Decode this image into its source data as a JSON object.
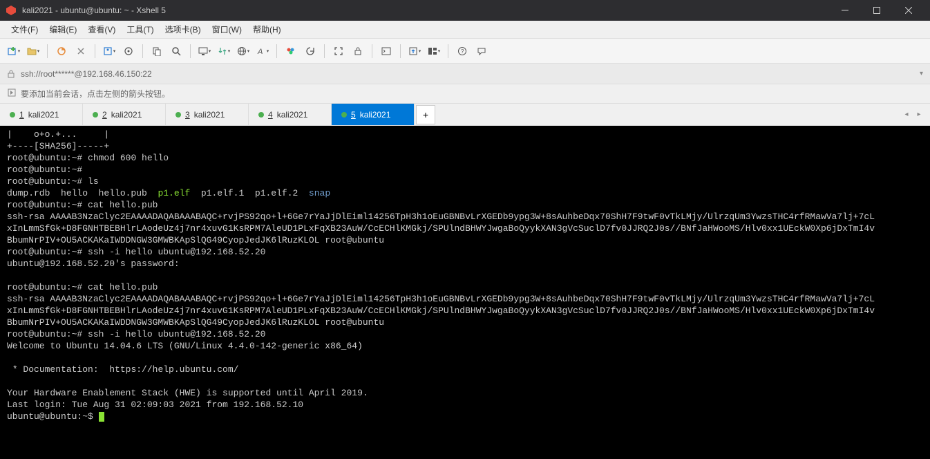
{
  "window": {
    "title": "kali2021 - ubuntu@ubuntu: ~ - Xshell 5"
  },
  "menubar": [
    "文件(F)",
    "编辑(E)",
    "查看(V)",
    "工具(T)",
    "选项卡(B)",
    "窗口(W)",
    "帮助(H)"
  ],
  "address": "ssh://root******@192.168.46.150:22",
  "tip": "要添加当前会话，点击左侧的箭头按钮。",
  "tabs": [
    {
      "num": "1",
      "label": "kali2021",
      "active": false
    },
    {
      "num": "2",
      "label": "kali2021",
      "active": false
    },
    {
      "num": "3",
      "label": "kali2021",
      "active": false
    },
    {
      "num": "4",
      "label": "kali2021",
      "active": false
    },
    {
      "num": "5",
      "label": "kali2021",
      "active": true
    }
  ],
  "terminal": {
    "randart": "|    o+o.+...     |",
    "sha_line": "+----[SHA256]-----+",
    "rootprompt": "root@ubuntu:~#",
    "ubuntuprompt": "ubuntu@ubuntu:~$",
    "cmd_chmod": "chmod 600 hello",
    "cmd_ls": "ls",
    "ls_out": {
      "p1": "dump.rdb  hello  hello.pub",
      "p2": "p1.elf",
      "p3": "p1.elf.1  p1.elf.2",
      "p4": "snap"
    },
    "cmd_cat": "cat hello.pub",
    "pub_l1": "ssh-rsa AAAAB3NzaClyc2EAAAADAQABAAABAQC+rvjPS92qo+l+6Ge7rYaJjDlEiml14256TpH3h1oEuGBNBvLrXGEDb9ypg3W+8sAuhbeDqx70ShH7F9twF0vTkLMjy/UlrzqUm3YwzsTHC4rfRMawVa7lj+7cL",
    "pub_l2": "xInLmmSfGk+D8FGNHTBEBHlrLAodeUz4j7nr4xuvG1KsRPM7AleUD1PLxFqXB23AuW/CcECHlKMGkj/SPUlndBHWYJwgaBoQyykXAN3gVcSuclD7fv0JJRQ2J0s//BNfJaHWooMS/Hlv0xx1UEckW0Xp6jDxTmI4v",
    "pub_l3": "BbumNrPIV+OU5ACKAKaIWDDNGW3GMWBKApSlQG49CyopJedJK6lRuzKLOL root@ubuntu",
    "cmd_ssh": "ssh -i hello ubuntu@192.168.52.20",
    "ssh_pw": "ubuntu@192.168.52.20's password:",
    "welcome": "Welcome to Ubuntu 14.04.6 LTS (GNU/Linux 4.4.0-142-generic x86_64)",
    "doc": " * Documentation:  https://help.ubuntu.com/",
    "hwe": "Your Hardware Enablement Stack (HWE) is supported until April 2019.",
    "last": "Last login: Tue Aug 31 02:09:03 2021 from 192.168.52.10"
  }
}
